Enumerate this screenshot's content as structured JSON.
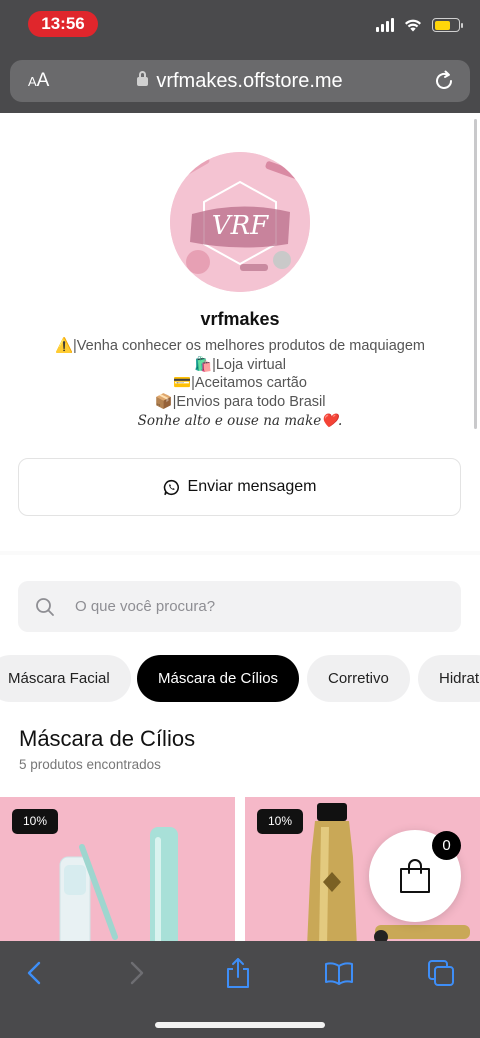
{
  "status_bar": {
    "time": "13:56",
    "battery_level": 0.68
  },
  "browser": {
    "text_size_label": "AA",
    "url": "vrfmakes.offstore.me",
    "icons": [
      "lock-icon",
      "reload-icon",
      "back-icon",
      "forward-icon",
      "share-icon",
      "bookmarks-icon",
      "tabs-icon"
    ]
  },
  "store": {
    "logo_text": "VRF",
    "name": "vrfmakes",
    "bio": [
      "⚠️|Venha conhecer os melhores produtos de maquiagem",
      "🛍️|Loja virtual",
      "💳|Aceitamos cartão",
      "📦|Envios para todo Brasil"
    ],
    "slogan": "Sonhe alto e ouse na make❤️.",
    "message_button": "Enviar mensagem"
  },
  "search": {
    "placeholder": "O que você procura?"
  },
  "categories": [
    {
      "label": "Máscara Facial",
      "active": false
    },
    {
      "label": "Máscara de Cílios",
      "active": true
    },
    {
      "label": "Corretivo",
      "active": false
    },
    {
      "label": "Hidrat",
      "active": false
    }
  ],
  "section": {
    "title": "Máscara de Cílios",
    "count": "5 produtos encontrados"
  },
  "products": [
    {
      "discount": "10%"
    },
    {
      "discount": "10%"
    }
  ],
  "cart": {
    "count": "0"
  },
  "colors": {
    "accent": "#000000",
    "pink": "#f5b8c8",
    "time_pill": "#e0262c"
  }
}
